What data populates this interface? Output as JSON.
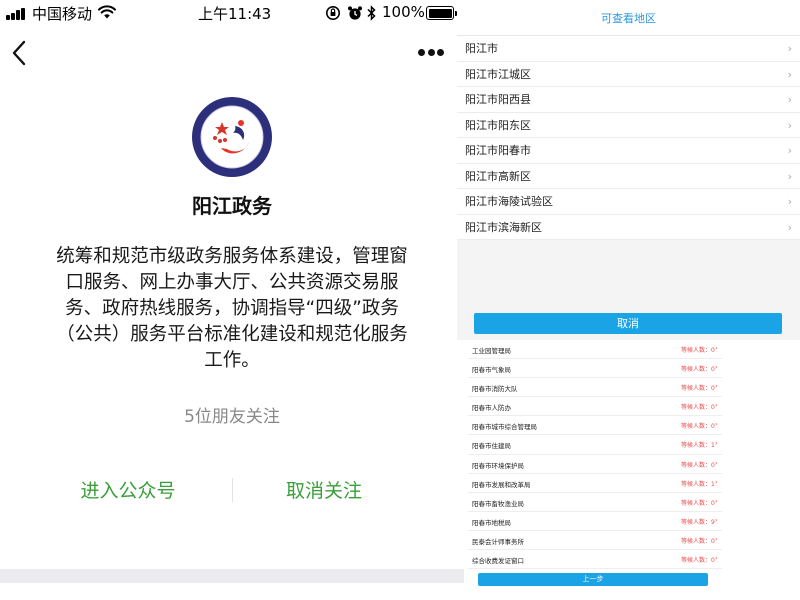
{
  "status_bar": {
    "carrier": "中国移动",
    "time": "上午11:43",
    "battery": "100%"
  },
  "account": {
    "name": "阳江政务",
    "description": "统筹和规范市级政务服务体系建设，管理窗口服务、网上办事大厅、公共资源交易服务、政府热线服务，协调指导“四级”政务（公共）服务平台标准化建设和规范化服务工作。",
    "friends_following": "5位朋友关注",
    "enter_label": "进入公众号",
    "unfollow_label": "取消关注"
  },
  "region_panel": {
    "title": "可查看地区",
    "items": [
      {
        "label": "阳江市"
      },
      {
        "label": "阳江市江城区"
      },
      {
        "label": "阳江市阳西县"
      },
      {
        "label": "阳江市阳东区"
      },
      {
        "label": "阳江市阳春市"
      },
      {
        "label": "阳江市高新区"
      },
      {
        "label": "阳江市海陵试验区"
      },
      {
        "label": "阳江市滨海新区"
      }
    ],
    "chevron": "›",
    "cancel_label": "取消"
  },
  "dept_panel": {
    "items": [
      {
        "name": "工业园管理局",
        "count": "等候人数：0"
      },
      {
        "name": "阳春市气象局",
        "count": "等候人数：0"
      },
      {
        "name": "阳春市消防大队",
        "count": "等候人数：0"
      },
      {
        "name": "阳春市人防办",
        "count": "等候人数：0"
      },
      {
        "name": "阳春市城市综合管理局",
        "count": "等候人数：0"
      },
      {
        "name": "阳春市住建局",
        "count": "等候人数：1"
      },
      {
        "name": "阳春市环境保护局",
        "count": "等候人数：0"
      },
      {
        "name": "阳春市发展和改革局",
        "count": "等候人数：1"
      },
      {
        "name": "阳春市畜牧渔业局",
        "count": "等候人数：0"
      },
      {
        "name": "阳春市地税局",
        "count": "等候人数：9"
      },
      {
        "name": "民泰会计师事务所",
        "count": "等候人数：0"
      },
      {
        "name": "综合收费发证窗口",
        "count": "等候人数：0"
      }
    ],
    "chevron": "›",
    "prev_label": "上一步"
  },
  "colors": {
    "wechat_green": "#3a9f3a",
    "accent_blue": "#1aa4e6",
    "title_blue": "#2d98da",
    "count_red": "#e84c4c"
  },
  "icons": [
    "signal-icon",
    "wifi-icon",
    "rotation-lock-icon",
    "alarm-icon",
    "bluetooth-icon",
    "battery-icon",
    "back-arrow-icon",
    "more-dots-icon",
    "chevron-right-icon"
  ]
}
